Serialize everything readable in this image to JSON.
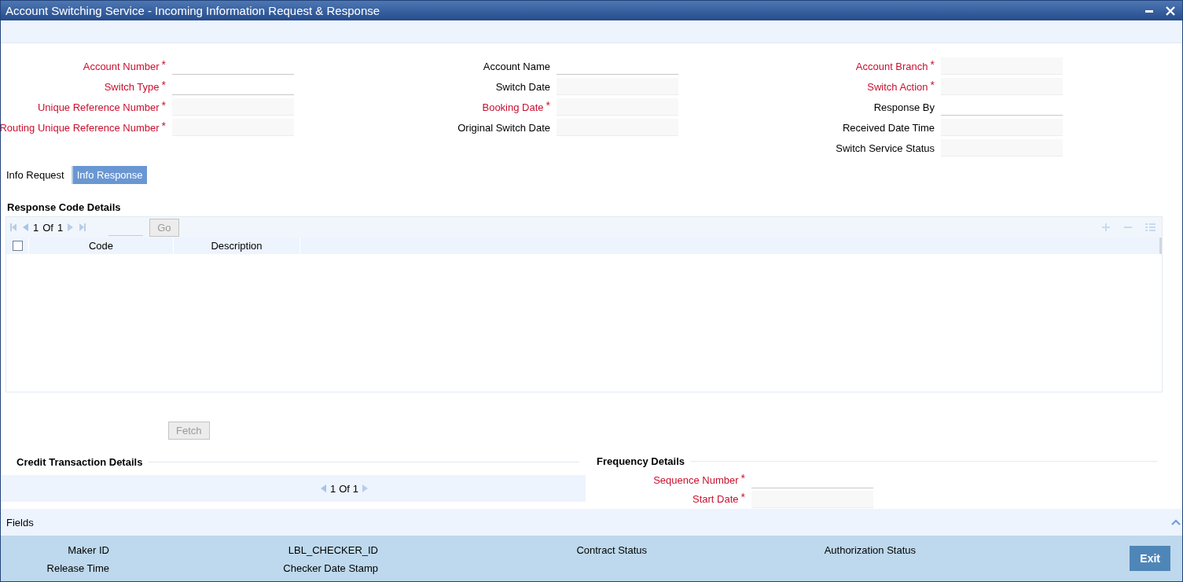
{
  "window": {
    "title": "Account Switching Service - Incoming Information Request & Response"
  },
  "form": {
    "columns": [
      [
        {
          "label": "Account Number",
          "required": true,
          "disabled": false
        },
        {
          "label": "Switch Type",
          "required": true,
          "disabled": false
        },
        {
          "label": "Unique Reference Number",
          "required": true,
          "disabled": true
        },
        {
          "label": "Routing Unique Reference Number",
          "required": true,
          "disabled": true
        }
      ],
      [
        {
          "label": "Account Name",
          "required": false,
          "disabled": false
        },
        {
          "label": "Switch Date",
          "required": false,
          "disabled": true
        },
        {
          "label": "Booking Date",
          "required": true,
          "disabled": true
        },
        {
          "label": "Original Switch Date",
          "required": false,
          "disabled": true
        }
      ],
      [
        {
          "label": "Account Branch",
          "required": true,
          "disabled": true
        },
        {
          "label": "Switch Action",
          "required": true,
          "disabled": true
        },
        {
          "label": "Response By",
          "required": false,
          "disabled": false
        },
        {
          "label": "Received Date Time",
          "required": false,
          "disabled": true
        },
        {
          "label": "Switch Service Status",
          "required": false,
          "disabled": true
        }
      ]
    ],
    "required_mark": "*"
  },
  "tabs": [
    {
      "label": "Info Request",
      "selected": false
    },
    {
      "label": "Info Response",
      "selected": true
    }
  ],
  "response_codes": {
    "title": "Response Code Details",
    "pager": {
      "current": "1",
      "of": "Of",
      "total": "1"
    },
    "go": "Go",
    "columns": [
      "Code",
      "Description"
    ],
    "select_all": false
  },
  "fetch": {
    "label": "Fetch",
    "disabled": true
  },
  "credit": {
    "title": "Credit Transaction Details",
    "pager": {
      "current": "1",
      "of": "Of",
      "total": "1"
    }
  },
  "frequency": {
    "title": "Frequency Details",
    "fields": [
      {
        "label": "Sequence Number",
        "required": true,
        "disabled": false
      },
      {
        "label": "Start Date",
        "required": true,
        "disabled": true
      }
    ]
  },
  "fields_bar": {
    "label": "Fields"
  },
  "footer": {
    "labels": [
      "Maker ID",
      "LBL_CHECKER_ID",
      "Contract Status",
      "Authorization Status",
      "Release Time",
      "Checker Date Stamp"
    ],
    "exit": "Exit"
  }
}
